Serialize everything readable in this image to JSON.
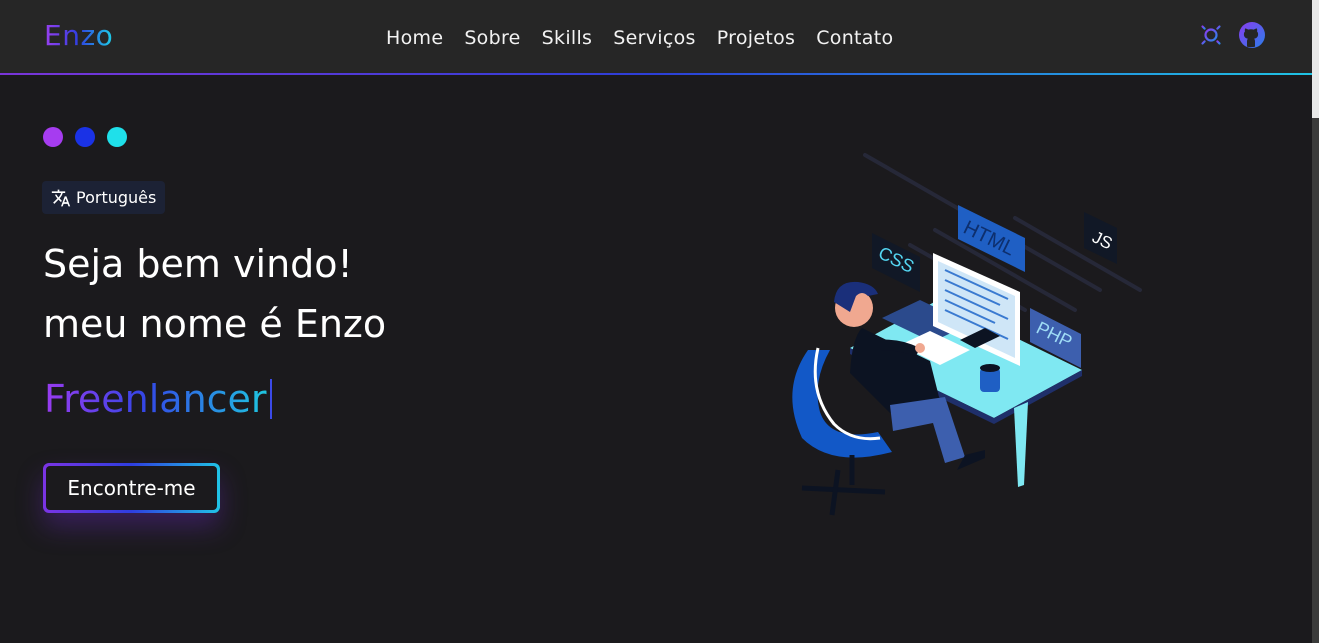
{
  "header": {
    "logo": "Enzo",
    "nav": [
      {
        "label": "Home"
      },
      {
        "label": "Sobre"
      },
      {
        "label": "Skills"
      },
      {
        "label": "Serviços"
      },
      {
        "label": "Projetos"
      },
      {
        "label": "Contato"
      }
    ],
    "icons": [
      "theme-toggle-sun-icon",
      "github-icon"
    ]
  },
  "hero": {
    "language_badge": "Português",
    "greeting_line1": "Seja bem vindo!",
    "greeting_line2": "meu nome é Enzo",
    "role": "Freenlancer",
    "cta_label": "Encontre-me",
    "illustration_tags": {
      "html": "HTML",
      "css": "CSS",
      "js": "JS",
      "php": "PHP"
    }
  },
  "colors": {
    "background": "#1b1a1d",
    "navbar": "#262626",
    "accent_purple": "#a63cf0",
    "accent_blue": "#1a32e6",
    "accent_cyan": "#1fe0ea"
  }
}
